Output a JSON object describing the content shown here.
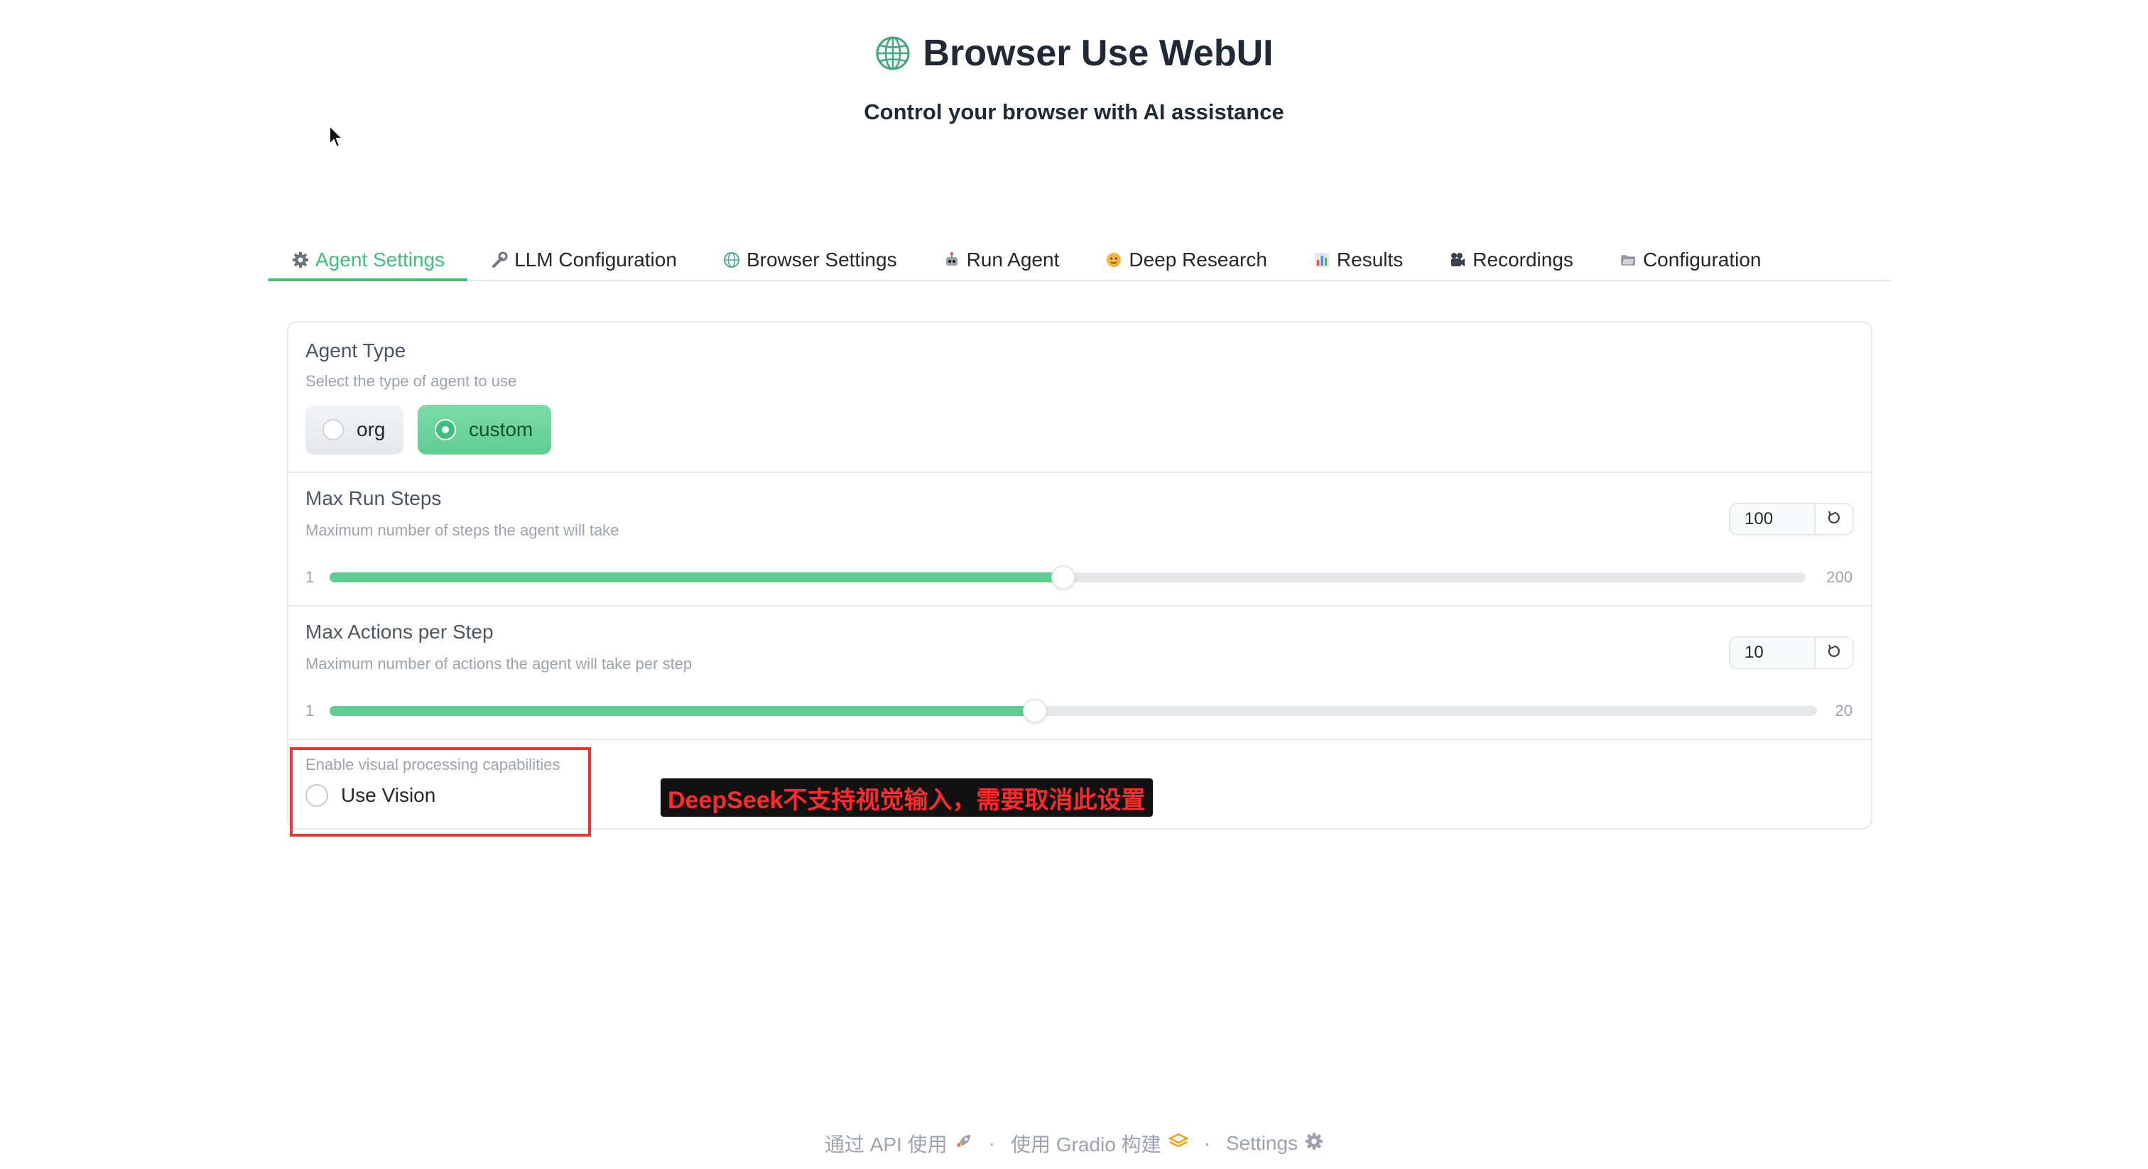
{
  "header": {
    "title": "Browser Use WebUI",
    "subtitle": "Control your browser with AI assistance"
  },
  "tabs": [
    {
      "label": "Agent Settings",
      "icon": "gear-icon",
      "active": true
    },
    {
      "label": "LLM Configuration",
      "icon": "wrench-icon",
      "active": false
    },
    {
      "label": "Browser Settings",
      "icon": "globe-icon",
      "active": false
    },
    {
      "label": "Run Agent",
      "icon": "robot-icon",
      "active": false
    },
    {
      "label": "Deep Research",
      "icon": "face-icon",
      "active": false
    },
    {
      "label": "Results",
      "icon": "bar-chart-icon",
      "active": false
    },
    {
      "label": "Recordings",
      "icon": "camera-icon",
      "active": false
    },
    {
      "label": "Configuration",
      "icon": "folder-icon",
      "active": false
    }
  ],
  "agent_type": {
    "label": "Agent Type",
    "info": "Select the type of agent to use",
    "options": [
      "org",
      "custom"
    ],
    "selected": "custom"
  },
  "max_steps": {
    "label": "Max Run Steps",
    "info": "Maximum number of steps the agent will take",
    "value": "100",
    "min": "1",
    "max": "200"
  },
  "max_actions": {
    "label": "Max Actions per Step",
    "info": "Maximum number of actions the agent will take per step",
    "value": "10",
    "min": "1",
    "max": "20"
  },
  "vision": {
    "info": "Enable visual processing capabilities",
    "label": "Use Vision",
    "checked": false
  },
  "annotation": {
    "note": "DeepSeek不支持视觉输入，需要取消此设置"
  },
  "footer": {
    "api": "通过 API 使用",
    "gradio": "使用 Gradio 构建",
    "settings": "Settings"
  },
  "colors": {
    "accent": "#3fbf7f",
    "annotation_red": "#e53935"
  }
}
